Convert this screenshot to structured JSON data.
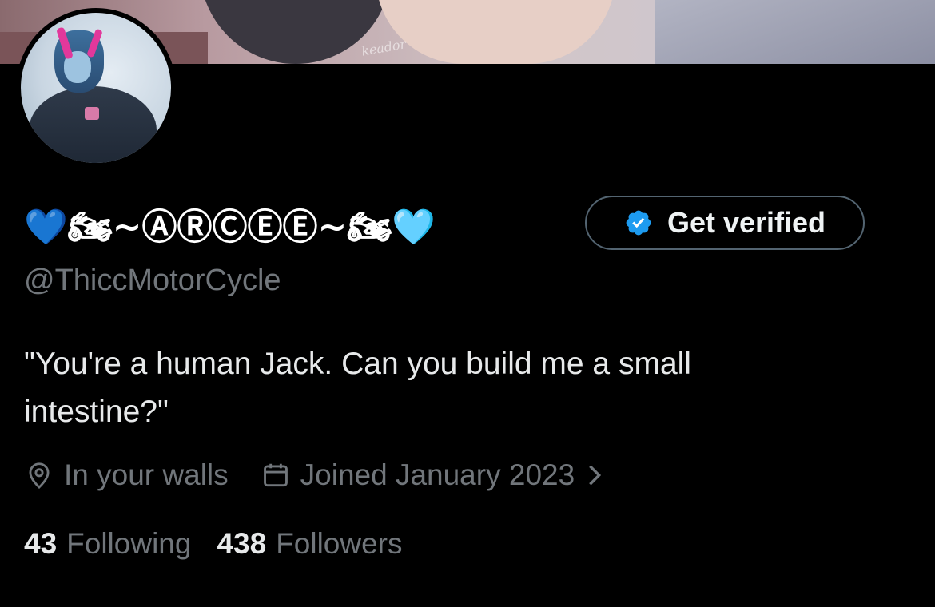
{
  "profile": {
    "display_name": "💙🏍~ⒶⓇⒸⒺⒺ~🏍🩵",
    "handle": "@ThiccMotorCycle",
    "bio": "\"You're a human Jack. Can you build me a small intestine?\"",
    "location": "In your walls",
    "joined": "Joined January 2023",
    "following_count": "43",
    "following_label": "Following",
    "followers_count": "438",
    "followers_label": "Followers"
  },
  "banner": {
    "watermark": "keador"
  },
  "actions": {
    "get_verified_label": "Get verified"
  },
  "icons": {
    "location": "location-pin-icon",
    "calendar": "calendar-icon",
    "chevron": "chevron-right-icon",
    "verified": "verified-badge-icon"
  },
  "colors": {
    "background": "#000000",
    "primary_text": "#e7e9ea",
    "secondary_text": "#71767b",
    "accent_blue": "#1d9bf0",
    "button_border": "#536471"
  }
}
